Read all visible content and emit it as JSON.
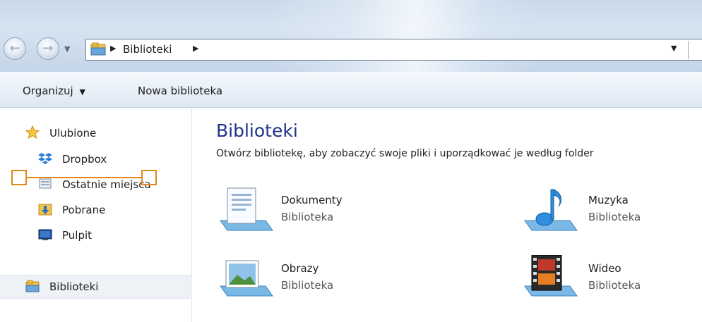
{
  "address": {
    "crumb": "Biblioteki"
  },
  "toolbar": {
    "organize": "Organizuj",
    "new_library": "Nowa biblioteka"
  },
  "sidebar": {
    "favorites": "Ulubione",
    "items": [
      {
        "label": "Dropbox"
      },
      {
        "label": "Ostatnie miejsca"
      },
      {
        "label": "Pobrane"
      },
      {
        "label": "Pulpit"
      }
    ],
    "libraries": "Biblioteki"
  },
  "main": {
    "title": "Biblioteki",
    "subtitle": "Otwórz bibliotekę, aby zobaczyć swoje pliki i uporządkować je według folder",
    "libraries": [
      {
        "name": "Dokumenty",
        "type": "Biblioteka",
        "icon": "documents-library-icon"
      },
      {
        "name": "Muzyka",
        "type": "Biblioteka",
        "icon": "music-library-icon"
      },
      {
        "name": "Obrazy",
        "type": "Biblioteka",
        "icon": "pictures-library-icon"
      },
      {
        "name": "Wideo",
        "type": "Biblioteka",
        "icon": "video-library-icon"
      }
    ]
  },
  "colors": {
    "title": "#1e3287",
    "annotation": "#e08a19"
  }
}
